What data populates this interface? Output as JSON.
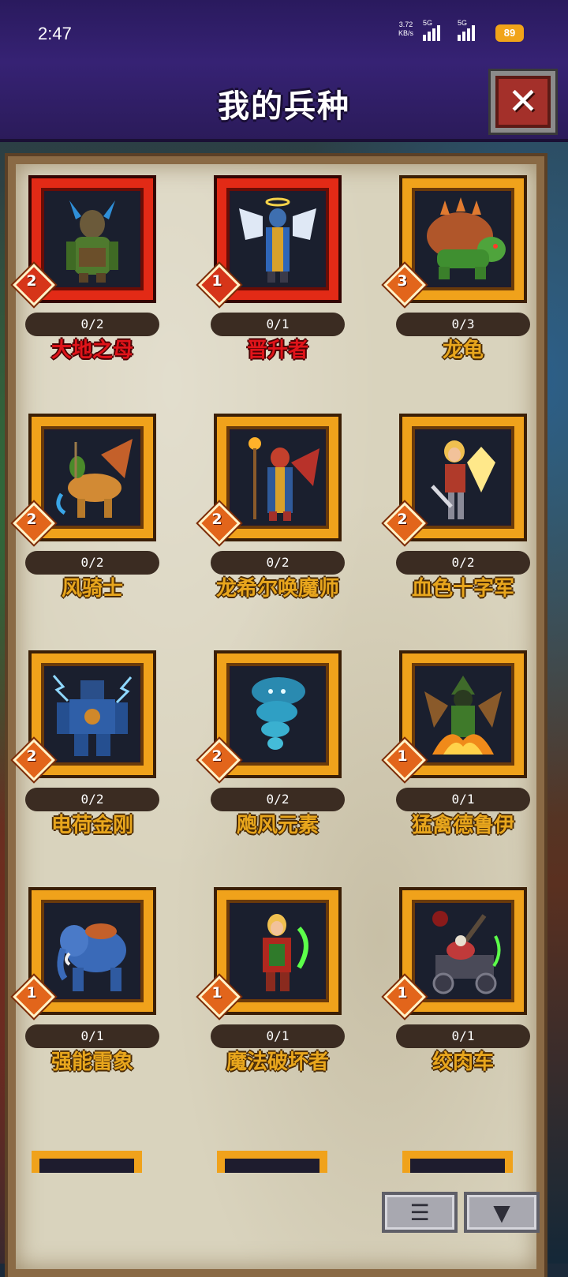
{
  "status_bar": {
    "time": "2:47",
    "net_speed": "3.72",
    "net_unit": "KB/s",
    "sim1": "5G",
    "sim2": "5G",
    "battery": "89"
  },
  "header": {
    "title": "我的兵种",
    "close_icon": "close-x-icon"
  },
  "units": [
    {
      "name": "大地之母",
      "count": "0/2",
      "level": "2",
      "frame": "red",
      "icon": "earth-mother-art"
    },
    {
      "name": "晋升者",
      "count": "0/1",
      "level": "1",
      "frame": "red",
      "icon": "ascendant-angel-art"
    },
    {
      "name": "龙龟",
      "count": "0/3",
      "level": "3",
      "frame": "gold",
      "icon": "dragon-turtle-art"
    },
    {
      "name": "风骑士",
      "count": "0/2",
      "level": "2",
      "frame": "gold",
      "icon": "wind-rider-art"
    },
    {
      "name": "龙希尔唤魔师",
      "count": "0/2",
      "level": "2",
      "frame": "gold",
      "icon": "dragon-summoner-art"
    },
    {
      "name": "血色十字军",
      "count": "0/2",
      "level": "2",
      "frame": "gold",
      "icon": "crusader-art"
    },
    {
      "name": "电荷金刚",
      "count": "0/2",
      "level": "2",
      "frame": "gold",
      "icon": "charged-golem-art"
    },
    {
      "name": "飑风元素",
      "count": "0/2",
      "level": "2",
      "frame": "gold",
      "icon": "storm-elemental-art"
    },
    {
      "name": "猛禽德鲁伊",
      "count": "0/1",
      "level": "1",
      "frame": "gold",
      "icon": "raptor-druid-art"
    },
    {
      "name": "强能雷象",
      "count": "0/1",
      "level": "1",
      "frame": "gold",
      "icon": "thunder-elephant-art"
    },
    {
      "name": "魔法破坏者",
      "count": "0/1",
      "level": "1",
      "frame": "gold",
      "icon": "spellbreaker-art"
    },
    {
      "name": "绞肉车",
      "count": "0/1",
      "level": "1",
      "frame": "gold",
      "icon": "meat-wagon-art"
    }
  ],
  "toolbar": {
    "list_icon": "list-icon",
    "filter_icon": "filter-icon"
  },
  "colors": {
    "header_bg": "#362274",
    "gold_frame": "#f0a21b",
    "red_frame": "#e22a16",
    "parchment": "#d9d3bd",
    "name_gold": "#e8a61d",
    "name_red": "#e0141a"
  }
}
